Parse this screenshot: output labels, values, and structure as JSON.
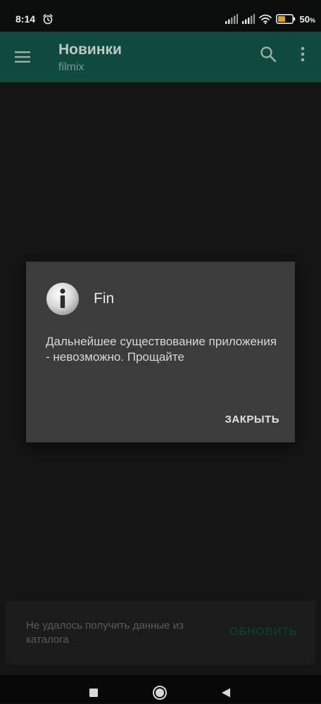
{
  "status_bar": {
    "time": "8:14",
    "battery_percent": "50",
    "battery_percent_sign": "%",
    "icons": [
      "alarm-icon",
      "signal-icon",
      "signal-icon",
      "wifi-icon",
      "battery-icon"
    ]
  },
  "app_bar": {
    "title": "Новинки",
    "subtitle": "filmix",
    "icons": [
      "menu-icon",
      "search-icon",
      "more-vert-icon"
    ],
    "background_color": "#0f4a3e"
  },
  "dialog": {
    "icon": "info-icon",
    "title": "Fin",
    "message": "Дальнейшее существование приложения - невозможно. Прощайте",
    "button_label": "ЗАКРЫТЬ"
  },
  "snackbar": {
    "message": "Не удалось получить данные из каталога",
    "action_label": "ОБНОВИТЬ"
  },
  "nav_bar": {
    "icons": [
      "recent-apps-icon",
      "home-icon",
      "back-icon"
    ]
  }
}
